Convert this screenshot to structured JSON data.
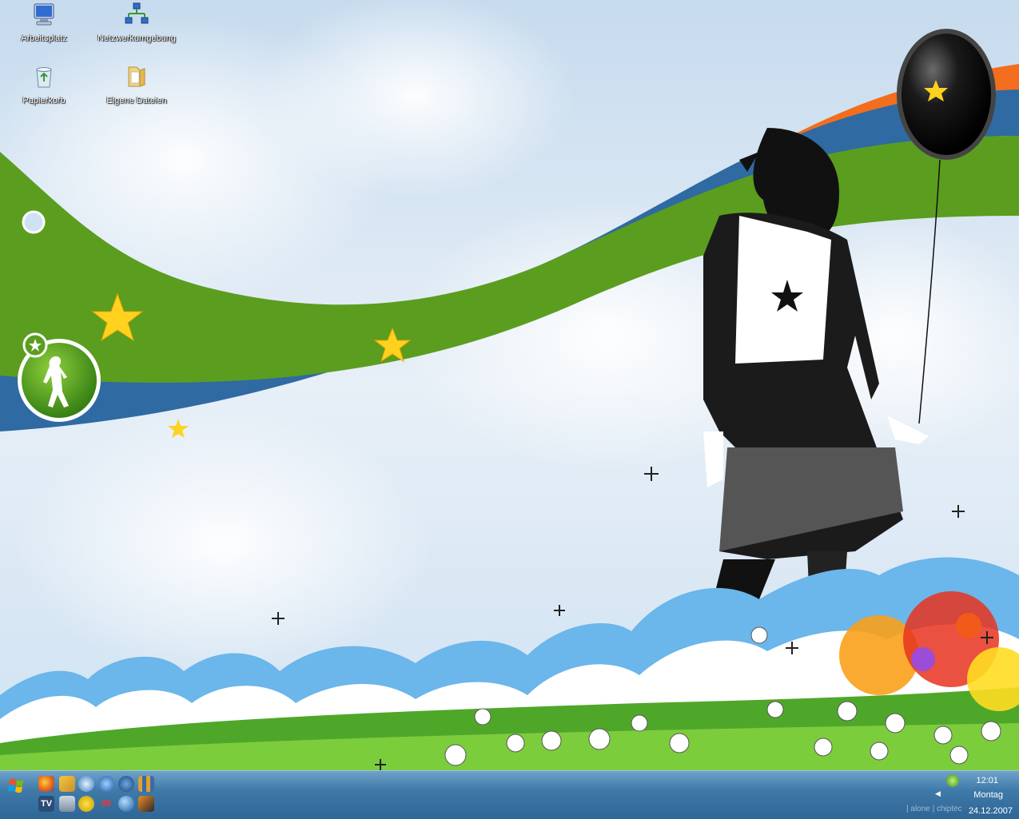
{
  "desktop_icons": [
    {
      "label": "Arbeitsplatz",
      "icon": "my-computer-icon"
    },
    {
      "label": "Netzwerkumgebung",
      "icon": "network-icon"
    },
    {
      "label": "Papierkorb",
      "icon": "recycle-bin-icon"
    },
    {
      "label": "Eigene Dateien",
      "icon": "my-documents-folder-icon"
    }
  ],
  "taskbar": {
    "start_icon": "windows-start-icon",
    "quick_launch": [
      {
        "icon": "firefox-icon"
      },
      {
        "icon": "paint-icon"
      },
      {
        "icon": "media-player-icon"
      },
      {
        "icon": "media-center-icon"
      },
      {
        "icon": "browser-icon"
      },
      {
        "icon": "app-grid-icon"
      },
      {
        "icon": "tv-icon",
        "text": "TV"
      },
      {
        "icon": "settings-icon"
      },
      {
        "icon": "power-icon"
      },
      {
        "icon": "red-app-icon",
        "text": "08"
      },
      {
        "icon": "globe-icon"
      },
      {
        "icon": "image-viewer-icon"
      }
    ],
    "tray": {
      "time": "12:01",
      "day": "Montag",
      "date": "24.12.2007",
      "extra_text": "| alone | chiptec"
    }
  },
  "colors": {
    "sky": "#dce9f5",
    "ribbon_green": "#5b9d1f",
    "ribbon_blue": "#2f6aa2",
    "ribbon_orange": "#f26e1e",
    "taskbar": "#3f7aa9"
  }
}
